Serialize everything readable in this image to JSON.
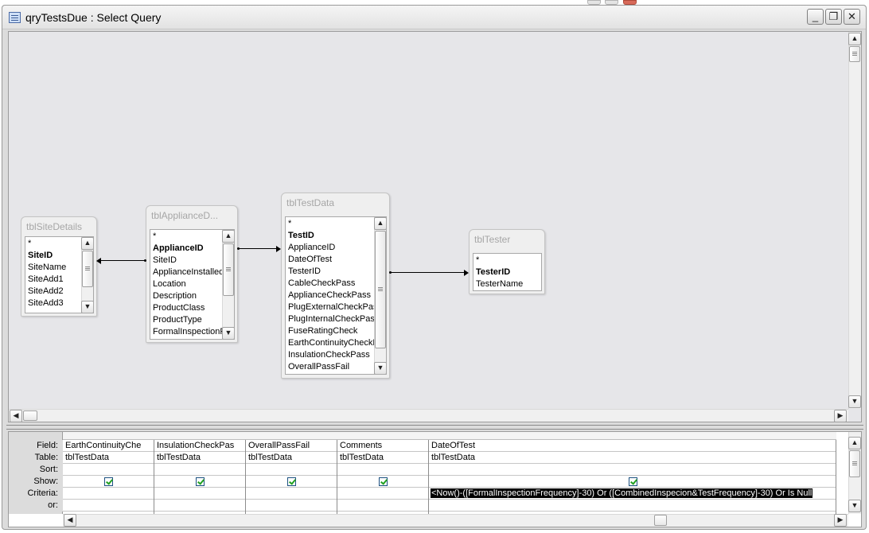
{
  "window": {
    "title": "qryTestsDue : Select Query",
    "minimize_label": "_",
    "restore_label": "❐",
    "close_label": "✕"
  },
  "scroll_glyphs": {
    "up": "▲",
    "down": "▼",
    "left": "◀",
    "right": "▶"
  },
  "tables": [
    {
      "name": "tblSiteDetails",
      "fields": [
        {
          "label": "*",
          "pk": false
        },
        {
          "label": "SiteID",
          "pk": true
        },
        {
          "label": "SiteName",
          "pk": false
        },
        {
          "label": "SiteAdd1",
          "pk": false
        },
        {
          "label": "SiteAdd2",
          "pk": false
        },
        {
          "label": "SiteAdd3",
          "pk": false
        }
      ]
    },
    {
      "name": "tblApplianceD...",
      "fields": [
        {
          "label": "*",
          "pk": false
        },
        {
          "label": "ApplianceID",
          "pk": true
        },
        {
          "label": "SiteID",
          "pk": false
        },
        {
          "label": "ApplianceInstalled",
          "pk": false
        },
        {
          "label": "Location",
          "pk": false
        },
        {
          "label": "Description",
          "pk": false
        },
        {
          "label": "ProductClass",
          "pk": false
        },
        {
          "label": "ProductType",
          "pk": false
        },
        {
          "label": "FormalInspectionF",
          "pk": false
        }
      ]
    },
    {
      "name": "tblTestData",
      "fields": [
        {
          "label": "*",
          "pk": false
        },
        {
          "label": "TestID",
          "pk": true
        },
        {
          "label": "ApplianceID",
          "pk": false
        },
        {
          "label": "DateOfTest",
          "pk": false
        },
        {
          "label": "TesterID",
          "pk": false
        },
        {
          "label": "CableCheckPass",
          "pk": false
        },
        {
          "label": "ApplianceCheckPass",
          "pk": false
        },
        {
          "label": "PlugExternalCheckPass",
          "pk": false
        },
        {
          "label": "PlugInternalCheckPass",
          "pk": false
        },
        {
          "label": "FuseRatingCheck",
          "pk": false
        },
        {
          "label": "EarthContinuityCheckF",
          "pk": false
        },
        {
          "label": "InsulationCheckPass",
          "pk": false
        },
        {
          "label": "OverallPassFail",
          "pk": false
        }
      ]
    },
    {
      "name": "tblTester",
      "fields": [
        {
          "label": "*",
          "pk": false
        },
        {
          "label": "TesterID",
          "pk": true
        },
        {
          "label": "TesterName",
          "pk": false
        }
      ]
    }
  ],
  "grid": {
    "row_labels": [
      "Field:",
      "Table:",
      "Sort:",
      "Show:",
      "Criteria:",
      "or:"
    ],
    "columns": [
      {
        "field": "EarthContinuityChe",
        "table": "tblTestData",
        "sort": "",
        "show": true,
        "criteria": "",
        "or": ""
      },
      {
        "field": "InsulationCheckPas",
        "table": "tblTestData",
        "sort": "",
        "show": true,
        "criteria": "",
        "or": ""
      },
      {
        "field": "OverallPassFail",
        "table": "tblTestData",
        "sort": "",
        "show": true,
        "criteria": "",
        "or": ""
      },
      {
        "field": "Comments",
        "table": "tblTestData",
        "sort": "",
        "show": true,
        "criteria": "",
        "or": ""
      },
      {
        "field": "DateOfTest",
        "table": "tblTestData",
        "sort": "",
        "show": true,
        "criteria": "<Now()-([FormalInspectionFrequency]-30) Or ([CombinedInspecion&TestFrequency]-30) Or Is Null",
        "or": ""
      }
    ]
  }
}
